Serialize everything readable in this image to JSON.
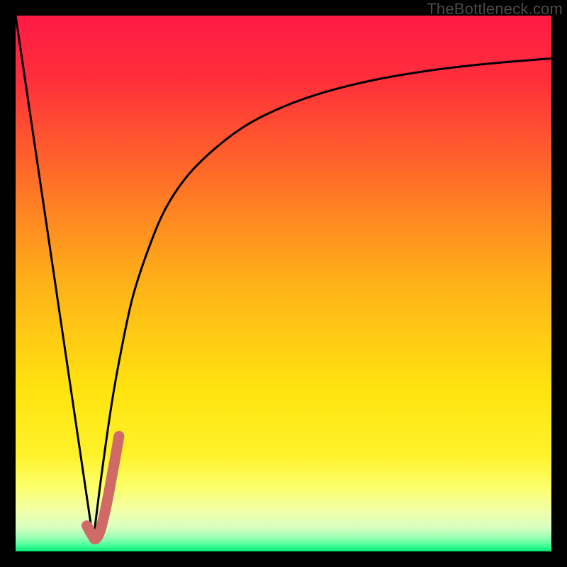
{
  "watermark": "TheBottleneck.com",
  "colors": {
    "frame": "#000000",
    "curve": "#000000",
    "marker": "#cf6a66",
    "gradient_stops": [
      {
        "offset": 0.0,
        "color": "#ff1a45"
      },
      {
        "offset": 0.12,
        "color": "#ff2f3b"
      },
      {
        "offset": 0.3,
        "color": "#ff6d28"
      },
      {
        "offset": 0.5,
        "color": "#ffb218"
      },
      {
        "offset": 0.7,
        "color": "#ffe40f"
      },
      {
        "offset": 0.82,
        "color": "#fff22a"
      },
      {
        "offset": 0.88,
        "color": "#fcff6b"
      },
      {
        "offset": 0.92,
        "color": "#f3ffa3"
      },
      {
        "offset": 0.955,
        "color": "#d8ffc0"
      },
      {
        "offset": 0.975,
        "color": "#98ffb3"
      },
      {
        "offset": 0.99,
        "color": "#3fff95"
      },
      {
        "offset": 1.0,
        "color": "#00e874"
      }
    ]
  },
  "chart_data": {
    "type": "line",
    "title": "",
    "xlabel": "",
    "ylabel": "",
    "xlim": [
      0,
      100
    ],
    "ylim": [
      0,
      100
    ],
    "grid": false,
    "series": [
      {
        "name": "left-line",
        "x": [
          0,
          14.5
        ],
        "y": [
          100,
          2
        ]
      },
      {
        "name": "right-curve",
        "x": [
          14.5,
          16,
          18,
          20,
          22,
          25,
          28,
          32,
          37,
          43,
          50,
          58,
          67,
          77,
          88,
          100
        ],
        "y": [
          2,
          14,
          28,
          39,
          48,
          57,
          64,
          70,
          75,
          79.5,
          83,
          85.8,
          88,
          89.7,
          91,
          92
        ]
      },
      {
        "name": "marker-hook",
        "note": "thick highlighted J-shaped segment near trough",
        "x": [
          13.3,
          14.3,
          14.9,
          15.7,
          16.5,
          17.3,
          18.0,
          18.7,
          19.3
        ],
        "y": [
          4.8,
          3.0,
          2.3,
          3.6,
          6.6,
          10.4,
          14.2,
          18.0,
          21.5
        ]
      }
    ]
  }
}
